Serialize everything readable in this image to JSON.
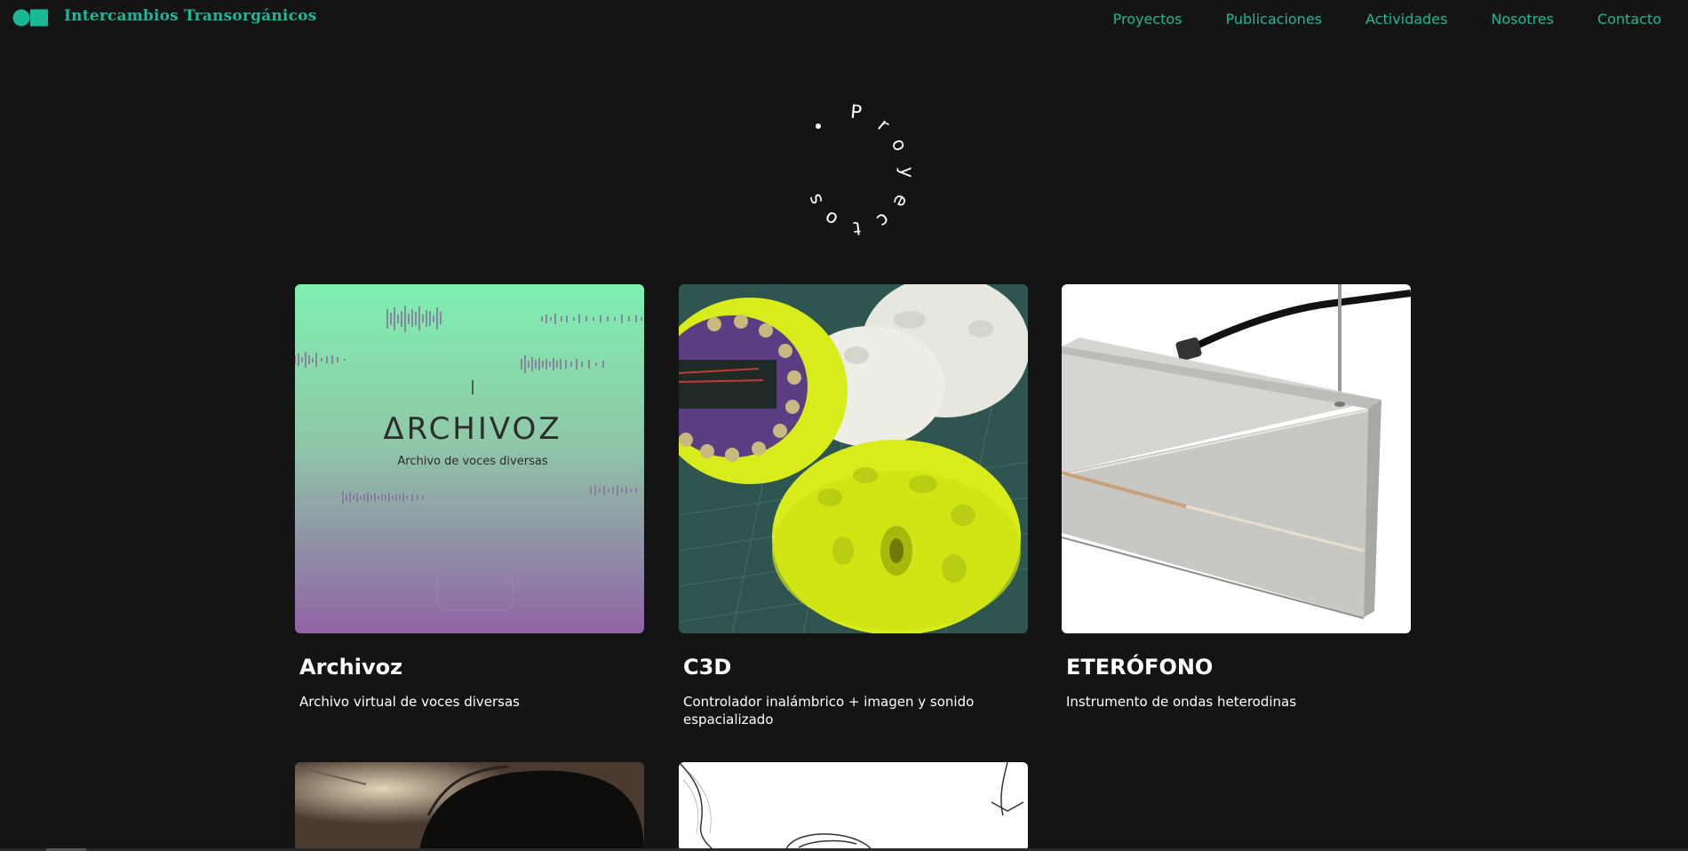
{
  "header": {
    "brand": "Intercambios Transorgánicos",
    "nav": [
      "Proyectos",
      "Publicaciones",
      "Actividades",
      "Nosotres",
      "Contacto"
    ]
  },
  "section": {
    "circle_letters": [
      "P",
      "r",
      "o",
      "y",
      "e",
      "c",
      "t",
      "o",
      "s"
    ]
  },
  "colors": {
    "accent": "#19b896",
    "background": "#141414"
  },
  "projects": [
    {
      "title": "Archivoz",
      "description": "Archivo virtual de voces diversas",
      "thumb_wordmark": "ΔRCHIVOZ",
      "thumb_caption": "Archivo de voces diversas"
    },
    {
      "title": "C3D",
      "description": "Controlador inalámbrico + imagen y sonido espacializado"
    },
    {
      "title": "ETERÓFONO",
      "description": "Instrumento de ondas heterodinas"
    },
    {
      "title": "",
      "description": ""
    },
    {
      "title": "",
      "description": ""
    }
  ]
}
